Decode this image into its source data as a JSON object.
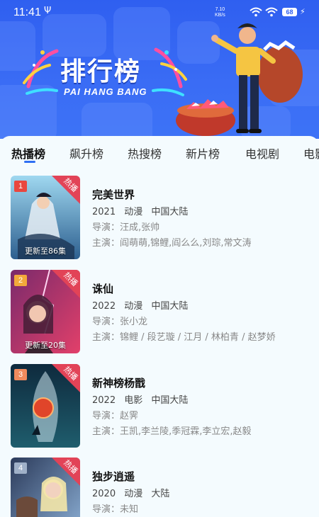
{
  "status_bar": {
    "time": "11:41",
    "speed_value": "7.10",
    "speed_unit": "KB/s",
    "battery": "68"
  },
  "banner": {
    "title": "排行榜",
    "subtitle": "PAI HANG BANG"
  },
  "tabs": [
    "热播榜",
    "飙升榜",
    "热搜榜",
    "新片榜",
    "电视剧",
    "电影"
  ],
  "active_tab": 0,
  "list": [
    {
      "rank": "1",
      "badge": "热播",
      "update": "更新至86集",
      "title": "完美世界",
      "year": "2021",
      "genre": "动漫",
      "region": "中国大陆",
      "director": "导演：汪成,张帅",
      "actors": "主演：阎萌萌,锦鲤,阎么么,刘琮,常文涛"
    },
    {
      "rank": "2",
      "badge": "热播",
      "update": "更新至20集",
      "title": "诛仙",
      "year": "2022",
      "genre": "动漫",
      "region": "中国大陆",
      "director": "导演：张小龙",
      "actors": "主演：锦鲤 / 段艺璇 / 江月 / 林柏青 / 赵梦娇"
    },
    {
      "rank": "3",
      "badge": "热播",
      "update": "",
      "title": "新神榜杨戬",
      "year": "2022",
      "genre": "电影",
      "region": "中国大陆",
      "director": "导演：赵霁",
      "actors": "主演：王凯,李兰陵,季冠霖,李立宏,赵毅"
    },
    {
      "rank": "4",
      "badge": "热播",
      "update": "",
      "title": "独步逍遥",
      "year": "2020",
      "genre": "动漫",
      "region": "大陆",
      "director": "导演：未知",
      "actors": ""
    }
  ],
  "colors": {
    "banner_blue": "#2f5ff0",
    "accent": "#2f6ff3",
    "hot_red": "#e24357",
    "rank1": "#e9473f",
    "rank2": "#f2a93b",
    "rank3": "#f08a5d",
    "rank4": "#9fb0c8"
  }
}
